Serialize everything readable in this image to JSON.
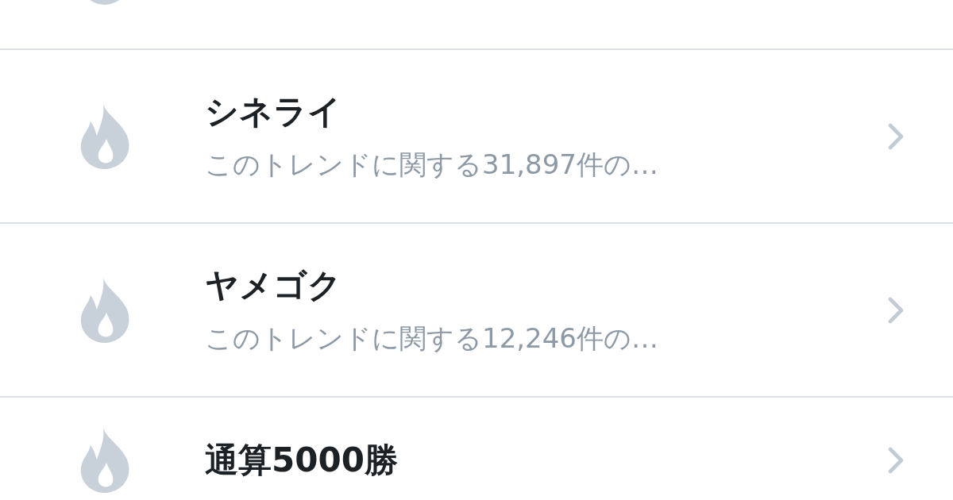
{
  "trends": [
    {
      "kind": "clipped"
    },
    {
      "kind": "trend",
      "title": "シネライ",
      "subtitle": "このトレンドに関する31,897件の…"
    },
    {
      "kind": "trend",
      "title": "ヤメゴク",
      "subtitle": "このトレンドに関する12,246件の…"
    },
    {
      "kind": "trend",
      "title": "通算5000勝"
    }
  ]
}
